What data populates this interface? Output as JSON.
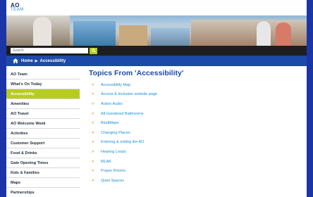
{
  "header": {
    "logo_line1": "AO",
    "logo_line2": "TEAM"
  },
  "search": {
    "placeholder": "Search"
  },
  "breadcrumb": {
    "home": "Home",
    "current": "Accessibility"
  },
  "sidebar": {
    "items": [
      {
        "label": "AO Team"
      },
      {
        "label": "What's On Today"
      },
      {
        "label": "Accessibility"
      },
      {
        "label": "Amenities"
      },
      {
        "label": "AO Travel"
      },
      {
        "label": "AO Welcome Week"
      },
      {
        "label": "Activities"
      },
      {
        "label": "Customer Support"
      },
      {
        "label": "Food & Drinks"
      },
      {
        "label": "Gate Opening Times"
      },
      {
        "label": "Kids & Families"
      },
      {
        "label": "Maps"
      },
      {
        "label": "Partnerships"
      }
    ],
    "active_index": 2
  },
  "main": {
    "title": "Topics From 'Accessibility'",
    "topics": [
      "Accessibility Map",
      "Access & Inclusion website page",
      "Action Audio",
      "All-Gendered Bathrooms",
      "BindiMaps",
      "Changing Places",
      "Entering & exiting the AO",
      "Hearing Loops",
      "MLAK",
      "Prayer Rooms",
      "Quiet Spaces"
    ]
  },
  "colors": {
    "page_bg": "#1c35a6",
    "brand_blue": "#1c4aa8",
    "accent_green": "#b7cd1d",
    "arrow_orange": "#f0a419"
  }
}
